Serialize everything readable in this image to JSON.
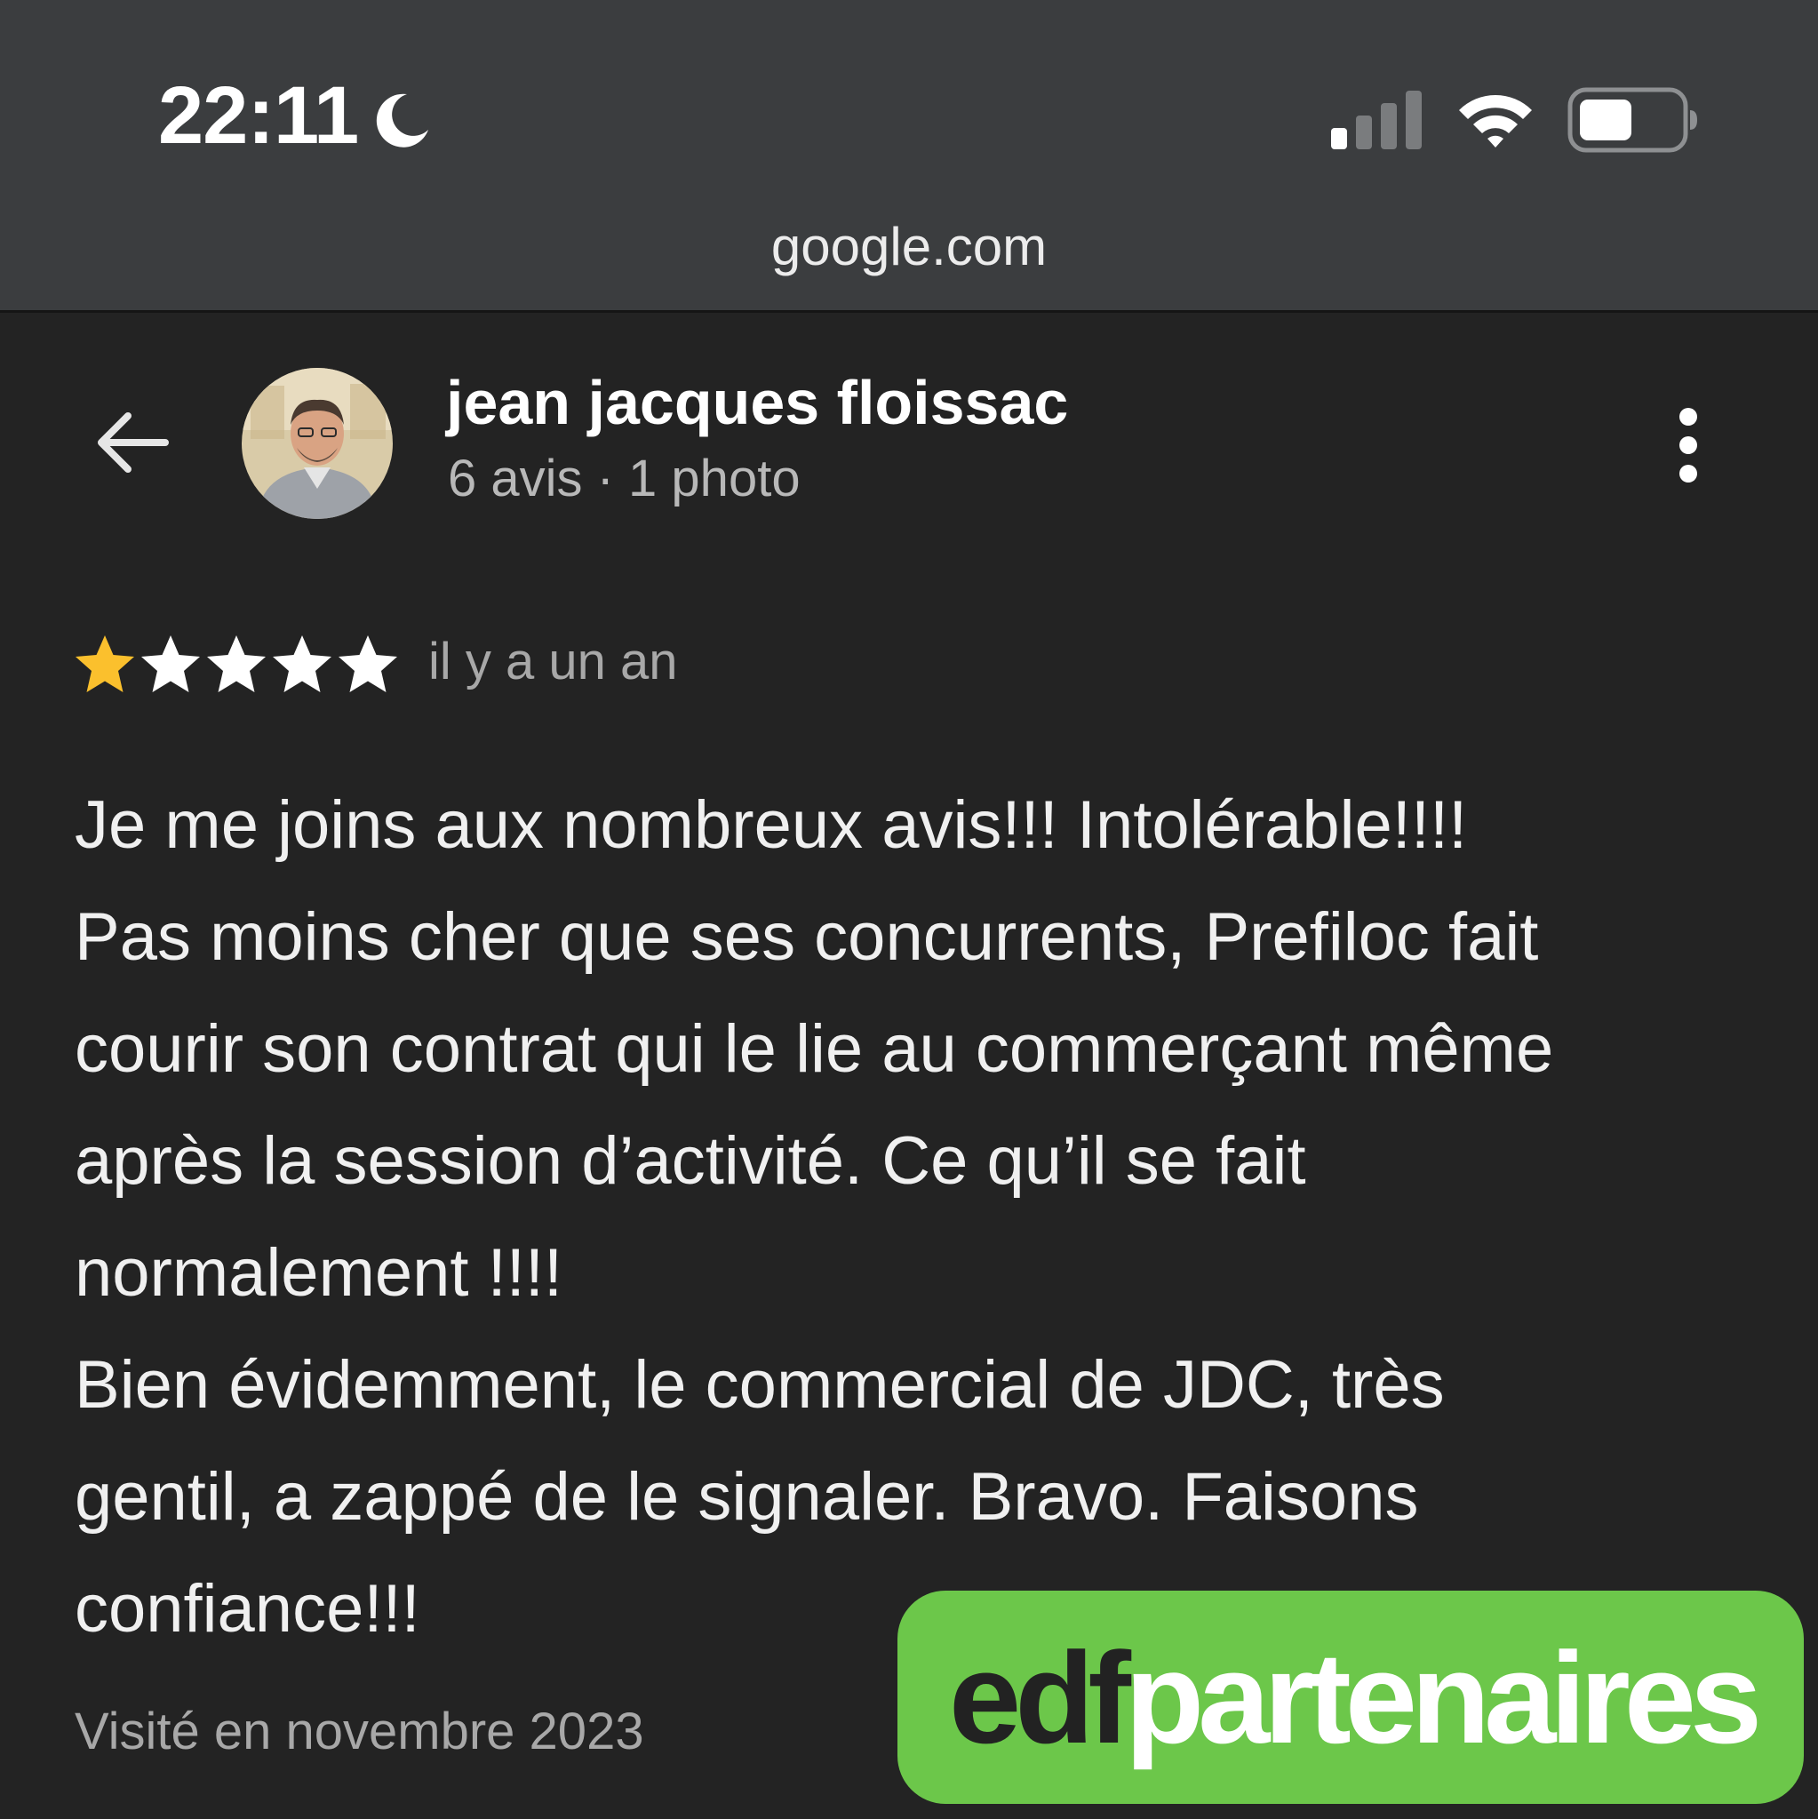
{
  "status_bar": {
    "time": "22:11",
    "focus_icon": "moon-icon",
    "signal_icon": "cellular-signal-icon",
    "wifi_icon": "wifi-icon",
    "battery_icon": "battery-icon",
    "battery_level": 0.5
  },
  "browser": {
    "url": "google.com"
  },
  "header": {
    "back_icon": "back-arrow-icon",
    "reviewer_name": "jean jacques floissac",
    "reviewer_stats": "6 avis · 1 photo",
    "more_icon": "more-vertical-icon"
  },
  "review": {
    "rating": 1,
    "max_rating": 5,
    "star_filled_color": "#fbc02d",
    "star_empty_color": "#ffffff",
    "date": "il y a un an",
    "lines": [
      "Je me joins aux nombreux avis!!! Intolérable!!!!",
      "Pas moins cher que ses concurrents, Prefiloc fait",
      "courir son contrat qui le lie au commerçant même",
      "après la session d’activité. Ce qu’il se fait",
      "normalement !!!!",
      "Bien évidemment, le commercial de JDC, très",
      "gentil, a zappé de le signaler. Bravo. Faisons",
      "confiance!!!"
    ],
    "visit": "Visité en novembre 2023"
  },
  "overlay_logo": {
    "part1": "edf",
    "part2": "partenaires",
    "background_color": "#6cc74a"
  }
}
